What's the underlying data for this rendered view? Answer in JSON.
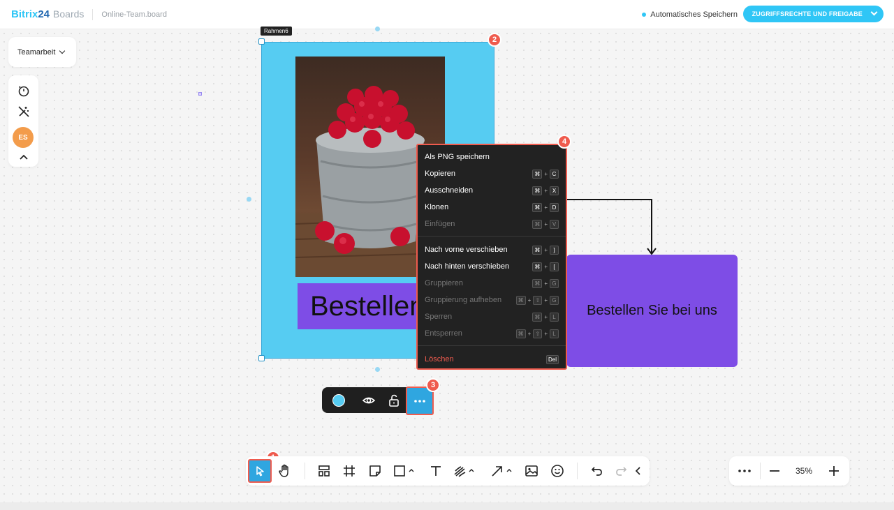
{
  "header": {
    "logo_main": "Bitrix",
    "logo_num": "24",
    "logo_sub": "Boards",
    "board_name": "Online-Team.board",
    "autosave_label": "Automatisches Speichern",
    "share_button_label": "ZUGRIFFSRECHTE UND FREIGABE"
  },
  "sidebar": {
    "workspace_label": "Teamarbeit",
    "avatar_initials": "ES",
    "tools": [
      "timer-icon",
      "magic-wand-off-icon",
      "avatar",
      "collapse-icon"
    ]
  },
  "canvas": {
    "frame_label": "Rahmen6",
    "frame_color": "#56ccf2",
    "text_card": "Bestellen Sie bei uns",
    "sticker_text": "Bestellen Sie bei uns",
    "sticker_color": "#7e4de6"
  },
  "badges": {
    "b1": "1",
    "b2": "2",
    "b3": "3",
    "b4": "4"
  },
  "context_menu": {
    "items": [
      {
        "label": "Als PNG speichern",
        "keys": []
      },
      {
        "label": "Kopieren",
        "keys": [
          "⌘",
          "C"
        ]
      },
      {
        "label": "Ausschneiden",
        "keys": [
          "⌘",
          "X"
        ]
      },
      {
        "label": "Klonen",
        "keys": [
          "⌘",
          "D"
        ]
      },
      {
        "label": "Einfügen",
        "keys": [
          "⌘",
          "V"
        ],
        "disabled": true
      },
      {
        "label": "Nach vorne verschieben",
        "keys": [
          "⌘",
          "]"
        ]
      },
      {
        "label": "Nach hinten verschieben",
        "keys": [
          "⌘",
          "["
        ]
      },
      {
        "label": "Gruppieren",
        "keys": [
          "⌘",
          "G"
        ],
        "disabled": true
      },
      {
        "label": "Gruppierung aufheben",
        "keys": [
          "⌘",
          "⇧",
          "G"
        ],
        "disabled": true
      },
      {
        "label": "Sperren",
        "keys": [
          "⌘",
          "L"
        ],
        "disabled": true
      },
      {
        "label": "Entsperren",
        "keys": [
          "⌘",
          "⇧",
          "L"
        ],
        "disabled": true
      },
      {
        "label": "Löschen",
        "keys": [
          "Del"
        ],
        "danger": true
      }
    ]
  },
  "object_toolbar": {
    "color_value": "#56ccf2",
    "items": [
      "color-picker",
      "visibility-icon",
      "unlock-icon",
      "more-options"
    ]
  },
  "bottom_toolbar": {
    "tools": [
      "select-tool",
      "hand-tool",
      "templates-tool",
      "frame-tool",
      "sticky-note-tool",
      "shape-tool",
      "text-tool",
      "pen-tool",
      "arrow-tool",
      "image-tool",
      "emoji-tool",
      "undo",
      "redo",
      "collapse"
    ]
  },
  "zoom": {
    "value": "35%"
  }
}
